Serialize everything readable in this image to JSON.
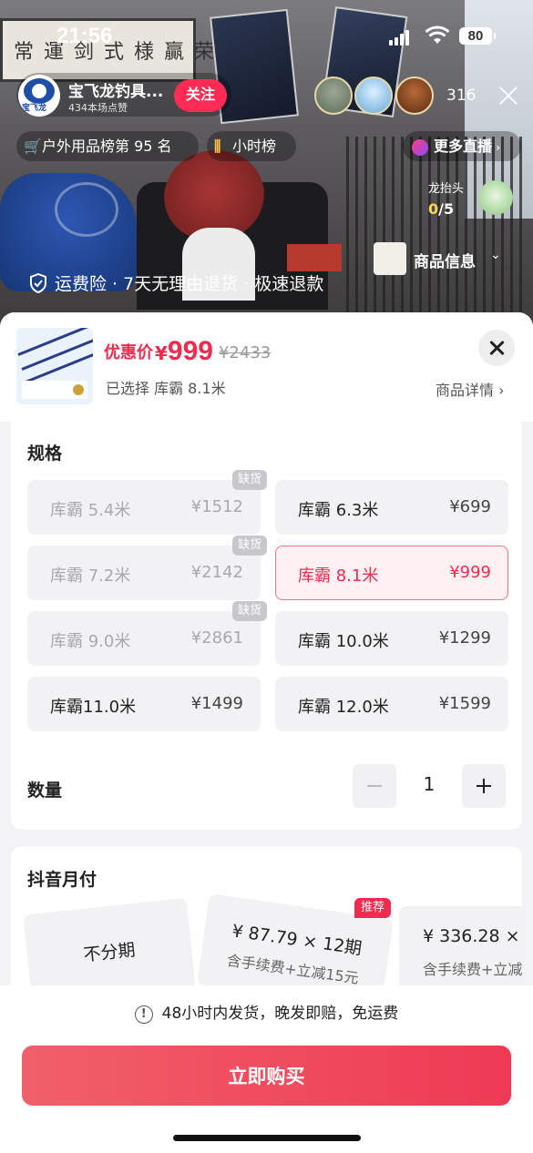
{
  "status_bar": {
    "time": "21:56",
    "battery": "80"
  },
  "streamer": {
    "name": "宝飞龙钓具...",
    "likes": "434本场点赞",
    "logo_text": "宝飞龙",
    "follow_label": "关注",
    "viewer_count": "316"
  },
  "chips": {
    "rank_label": "户外用品榜第 95 名",
    "hour_label": "小时榜",
    "more_label": "更多直播"
  },
  "dragon": {
    "label": "龙抬头",
    "count_done": "0",
    "count_total": "/5"
  },
  "goods_info_label": "商品信息",
  "guarantee": "运费险 · 7天无理由退货 · 极速退款",
  "product": {
    "price_label": "优惠价",
    "currency": "¥",
    "price": "999",
    "original_price": "¥2433",
    "selected": "已选择 库霸  8.1米",
    "detail_link": "商品详情 ›"
  },
  "spec": {
    "title": "规格",
    "oos_tag": "缺货",
    "items": [
      {
        "name": "库霸   5.4米",
        "price": "¥1512",
        "state": "oos"
      },
      {
        "name": "库霸   6.3米",
        "price": "¥699",
        "state": "normal"
      },
      {
        "name": "库霸   7.2米",
        "price": "¥2142",
        "state": "oos"
      },
      {
        "name": "库霸   8.1米",
        "price": "¥999",
        "state": "selected"
      },
      {
        "name": "库霸   9.0米",
        "price": "¥2861",
        "state": "oos"
      },
      {
        "name": "库霸   10.0米",
        "price": "¥1299",
        "state": "normal"
      },
      {
        "name": "库霸11.0米",
        "price": "¥1499",
        "state": "normal"
      },
      {
        "name": "库霸   12.0米",
        "price": "¥1599",
        "state": "normal"
      }
    ]
  },
  "quantity": {
    "label": "数量",
    "value": "1"
  },
  "pay": {
    "title": "抖音月付",
    "recommend_tag": "推荐",
    "options": [
      {
        "main": "不分期",
        "sub": ""
      },
      {
        "main": "¥ 87.79 × 12期",
        "sub": "含手续费+立减15元"
      },
      {
        "main": "¥ 336.28 ×",
        "sub": "含手续费+立减"
      }
    ]
  },
  "footer": {
    "notice": "48小时内发货，晚发即赔，免运费",
    "buy_label": "立即购买"
  },
  "colors": {
    "accent": "#f02b4f",
    "follow": "#fe2c55",
    "buy_start": "#f0606a",
    "buy_end": "#ef3a55"
  }
}
